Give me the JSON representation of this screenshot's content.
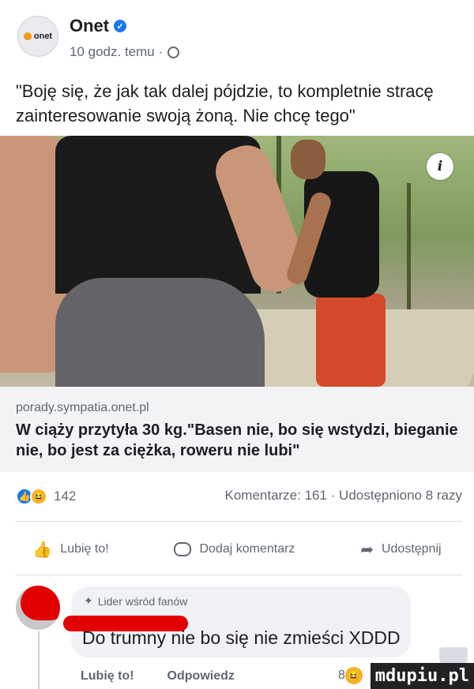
{
  "post": {
    "page_name": "Onet",
    "avatar_text": "onet",
    "time": "10 godz. temu ·",
    "text": "\"Boję się, że jak tak dalej pójdzie, to kompletnie stracę zainteresowanie swoją żoną. Nie chcę tego\""
  },
  "link": {
    "domain": "porady.sympatia.onet.pl",
    "title": "W ciąży przytyła 30 kg.\"Basen nie, bo się wstydzi, bieganie nie, bo jest za ciężka, roweru nie lubi\""
  },
  "stats": {
    "reactions_count": "142",
    "comments_shares": "Komentarze: 161 · Udostępniono 8 razy"
  },
  "actions": {
    "like": "Lubię to!",
    "comment": "Dodaj komentarz",
    "share": "Udostępnij"
  },
  "comment": {
    "badge": "Lider wśród fanów",
    "text": "Do trumny nie bo się nie zmieści XDDD",
    "like": "Lubię to!",
    "reply": "Odpowiedz",
    "reaction_count": "8"
  },
  "watermark": "mdupiu.pl",
  "colors": {
    "facebook_blue": "#1877f2",
    "text_gray": "#606770",
    "link_bg": "#f2f3f5",
    "censor_red": "#e30000"
  },
  "icons": [
    "verified-icon",
    "globe-icon",
    "info-icon",
    "like-reaction-icon",
    "haha-reaction-icon",
    "thumb-up-icon",
    "comment-icon",
    "share-icon",
    "star-badge-icon"
  ]
}
